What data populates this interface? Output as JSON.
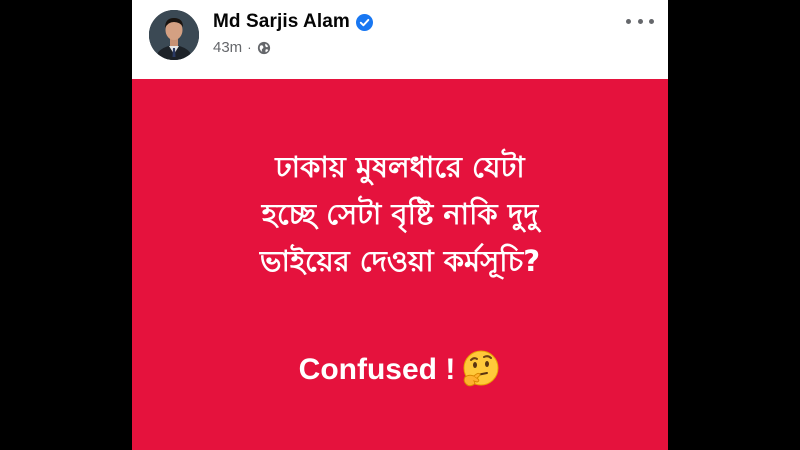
{
  "post": {
    "author": {
      "name": "Md Sarjis Alam",
      "verified": true
    },
    "meta": {
      "time": "43m",
      "separator": "·",
      "audience_icon": "globe-icon"
    },
    "more_icon": "more-options-icon",
    "content": {
      "background_color": "#e5123d",
      "text_color": "#ffffff",
      "lines": [
        "ঢাকায় মুষলধারে যেটা",
        "হচ্ছে সেটা বৃষ্টি নাকি দুদু",
        "ভাইয়ের দেওয়া কর্মসূচি?"
      ],
      "confused_text": "Confused !",
      "emoji_icon": "thinking-face-icon"
    }
  },
  "colors": {
    "verified_badge": "#1877f2",
    "meta_text": "#65676b",
    "name_text": "#050505"
  }
}
